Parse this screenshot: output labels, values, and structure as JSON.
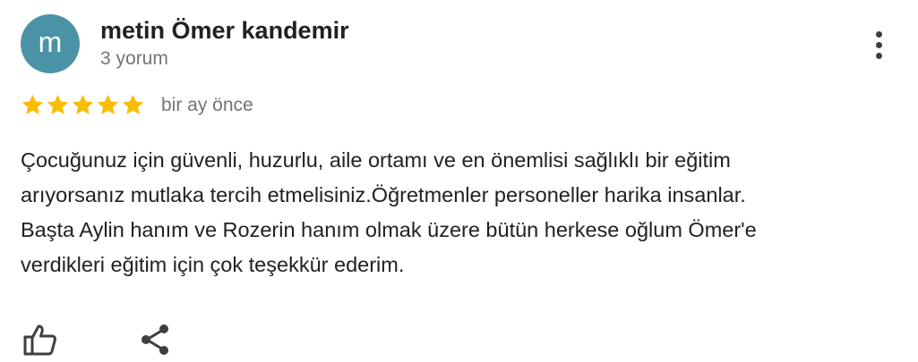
{
  "author": {
    "initial": "m",
    "name": "metin Ömer kandemir",
    "review_count": "3 yorum",
    "avatar_color": "#4a93a6"
  },
  "rating": {
    "stars": 5,
    "max": 5,
    "star_color": "#fbbc04",
    "date": "bir ay önce"
  },
  "review": {
    "lines": [
      "Çocuğunuz için güvenli, huzurlu, aile ortamı ve en önemlisi sağlıklı bir eğitim",
      "arıyorsanız mutlaka tercih etmelisiniz.Öğretmenler personeller harika insanlar.",
      "Başta Aylin hanım ve Rozerin hanım olmak üzere bütün herkese oğlum Ömer'e",
      "verdikleri eğitim için çok teşekkür ederim."
    ]
  },
  "icons": {
    "more": "more-vertical-icon",
    "like": "thumbs-up-icon",
    "share": "share-icon"
  }
}
